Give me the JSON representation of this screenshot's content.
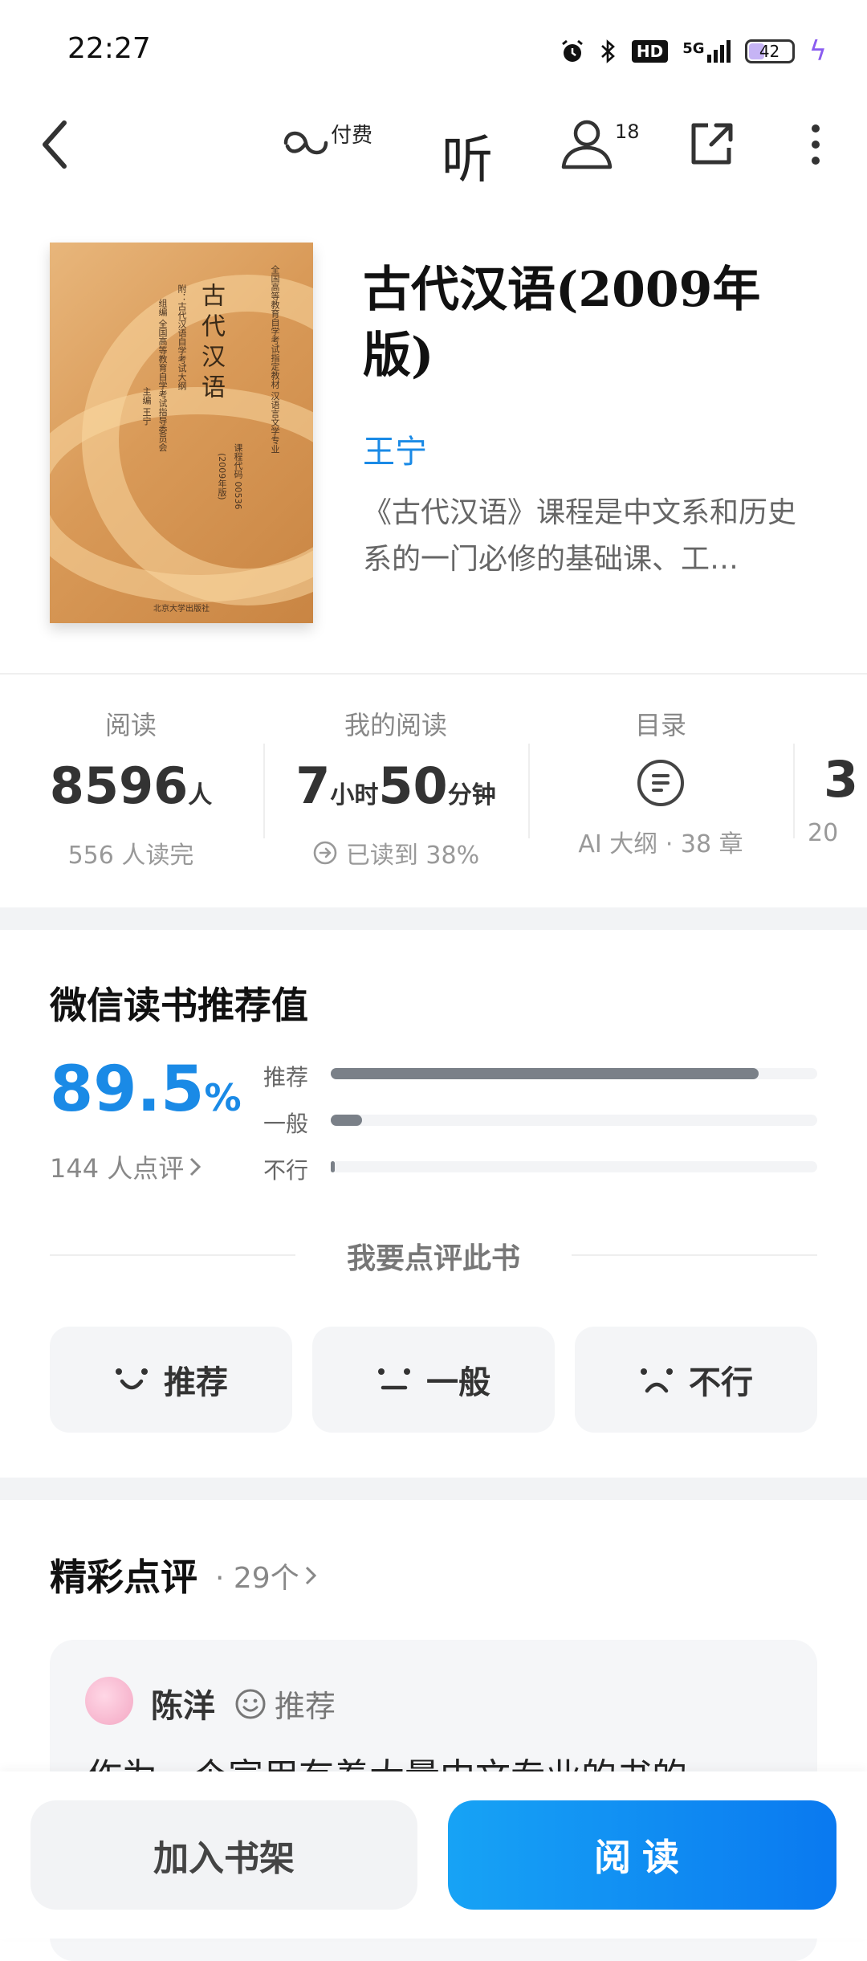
{
  "status_bar": {
    "time": "22:27",
    "hd": "HD",
    "signal": "5G",
    "battery": "42",
    "battery_level_percent": 42,
    "icons": [
      "alarm-icon",
      "bluetooth-icon",
      "signal-icon",
      "charging-icon"
    ]
  },
  "nav": {
    "pay_label": "付费",
    "listen_label": "听",
    "friends_count": "18",
    "icons": [
      "back-icon",
      "infinity-icon",
      "listen-icon",
      "person-icon",
      "share-icon",
      "more-icon"
    ]
  },
  "book": {
    "title": "古代汉语(2009年版)",
    "author": "王宁",
    "description": "《古代汉语》课程是中文系和历史系的一门必修的基础课、工…",
    "cover": {
      "title": "古代汉语",
      "line1": "全国高等教育自学考试指定教材 汉语言文学专业",
      "line2": "附：古代汉语自学考试大纲",
      "line3": "组编 全国高等教育自学考试指导委员会",
      "line4": "主编 王宁",
      "line5": "课程代码 00536",
      "line6": "(2009年版)",
      "publisher": "北京大学出版社"
    }
  },
  "stats": [
    {
      "label": "阅读",
      "value": "8596",
      "unit": "人",
      "sub": "556 人读完"
    },
    {
      "label": "我的阅读",
      "hours": "7",
      "hours_unit": "小时",
      "minutes": "50",
      "minutes_unit": "分钟",
      "sub": "已读到 38%"
    },
    {
      "label": "目录",
      "sub": "AI 大纲 · 38 章"
    },
    {
      "value_partial": "3",
      "sub_partial": "20"
    }
  ],
  "recommend": {
    "title": "微信读书推荐值",
    "score": "89.5",
    "score_unit": "%",
    "count": "144 人点评",
    "bars": [
      {
        "label": "推荐",
        "fraction": 0.88
      },
      {
        "label": "一般",
        "fraction": 0.065
      },
      {
        "label": "不行",
        "fraction": 0.008
      }
    ],
    "prompt": "我要点评此书",
    "buttons": [
      {
        "label": "推荐",
        "icon": "smile-face-icon"
      },
      {
        "label": "一般",
        "icon": "neutral-face-icon"
      },
      {
        "label": "不行",
        "icon": "sad-face-icon"
      }
    ]
  },
  "reviews": {
    "title": "精彩点评",
    "count": "· 29个",
    "first": {
      "name": "陈洋",
      "rating": "推荐",
      "text": "作为一个宣用有着大量中文专业的书的"
    }
  },
  "bottom": {
    "shelf_label": "加入书架",
    "read_label": "阅读"
  },
  "colors": {
    "accent_blue": "#1a8ae6",
    "read_button_gradient": [
      "#17a3f5",
      "#0a79f0"
    ],
    "bar_fill": "#7a8088"
  }
}
